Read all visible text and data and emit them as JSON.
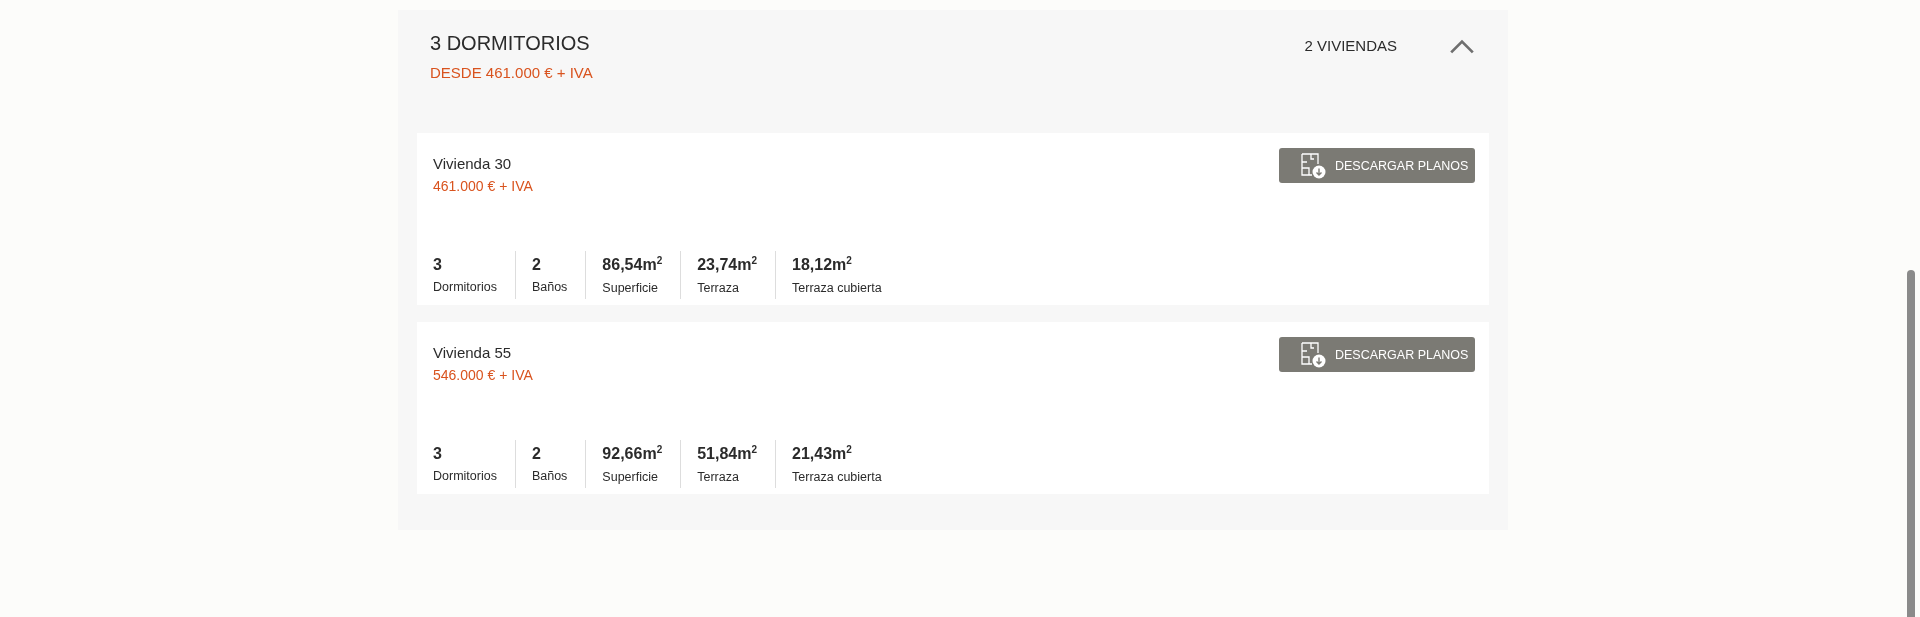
{
  "group": {
    "title": "3 DORMITORIOS",
    "price": "DESDE 461.000 € + IVA",
    "count": "2 VIVIENDAS",
    "expanded": true
  },
  "units": [
    {
      "name": "Vivienda 30",
      "price": "461.000 € + IVA",
      "button": "DESCARGAR PLANOS",
      "stats": [
        {
          "value": "3",
          "label": "Dormitorios"
        },
        {
          "value": "2",
          "label": "Baños"
        },
        {
          "value": "86,54m$^{2}$",
          "label": "Superficie"
        },
        {
          "value": "23,74m$^{2}$",
          "label": "Terraza"
        },
        {
          "value": "18,12m$^{2}$",
          "label": "Terraza cubierta"
        }
      ]
    },
    {
      "name": "Vivienda 55",
      "price": "546.000 € + IVA",
      "button": "DESCARGAR PLANOS",
      "stats": [
        {
          "value": "3",
          "label": "Dormitorios"
        },
        {
          "value": "2",
          "label": "Baños"
        },
        {
          "value": "92,66m$^{2}$",
          "label": "Superficie"
        },
        {
          "value": "51,84m$^{2}$",
          "label": "Terraza"
        },
        {
          "value": "21,43m$^{2}$",
          "label": "Terraza cubierta"
        }
      ]
    }
  ]
}
